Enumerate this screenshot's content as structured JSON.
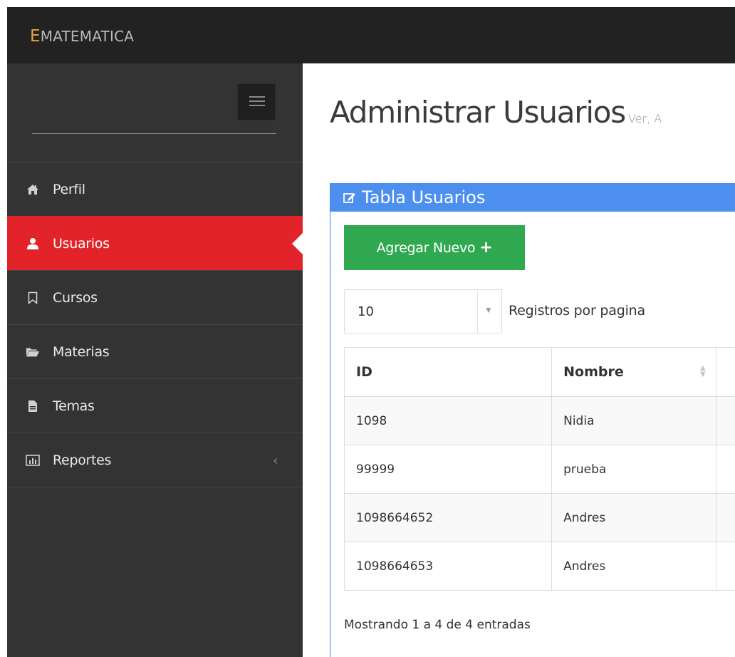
{
  "app": {
    "brand_initial": "E",
    "brand_rest": "MATEMATICA"
  },
  "sidebar": {
    "items": [
      {
        "label": "Perfil",
        "icon": "home-icon",
        "active": false
      },
      {
        "label": "Usuarios",
        "icon": "user-icon",
        "active": true
      },
      {
        "label": "Cursos",
        "icon": "bookmark-icon",
        "active": false
      },
      {
        "label": "Materias",
        "icon": "folder-open-icon",
        "active": false
      },
      {
        "label": "Temas",
        "icon": "file-icon",
        "active": false
      },
      {
        "label": "Reportes",
        "icon": "bar-chart-icon",
        "active": false,
        "chevron": "‹"
      }
    ]
  },
  "page": {
    "title": "Administrar Usuarios",
    "subtitle": "Ver, A"
  },
  "panel": {
    "heading": "Tabla Usuarios",
    "add_button_label": "Agregar Nuevo",
    "add_button_plus": "+",
    "page_length_value": "10",
    "page_length_label": "Registros por pagina",
    "columns": [
      "ID",
      "Nombre"
    ],
    "rows": [
      {
        "id": "1098",
        "nombre": "Nidia"
      },
      {
        "id": "99999",
        "nombre": "prueba"
      },
      {
        "id": "1098664652",
        "nombre": "Andres"
      },
      {
        "id": "1098664653",
        "nombre": "Andres"
      }
    ],
    "info": "Mostrando 1 a 4 de 4 entradas"
  },
  "colors": {
    "topbar": "#222222",
    "sidebar": "#333333",
    "active_item": "#e2232a",
    "panel_heading": "#4c8fef",
    "add_button": "#2fa84f",
    "brand_accent": "#e8a13c"
  }
}
